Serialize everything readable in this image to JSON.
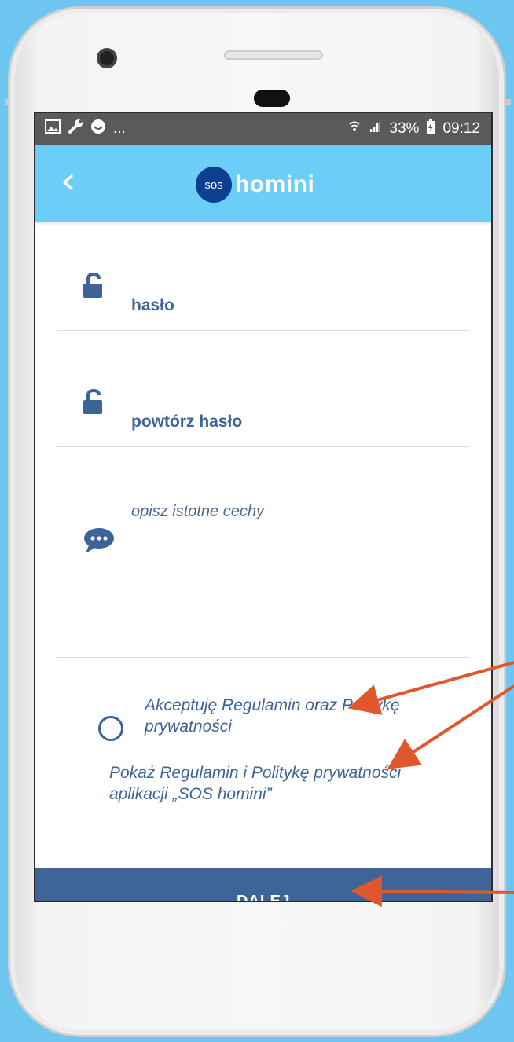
{
  "status_bar": {
    "left_icons": [
      "image-icon",
      "wrench-icon",
      "smiley-icon"
    ],
    "left_more": "...",
    "right_icons": [
      "wifi-icon",
      "signal-icon"
    ],
    "battery_percent": "33%",
    "time": "09:12"
  },
  "app_bar": {
    "back_icon": "chevron-left-icon",
    "logo_badge": "sos",
    "logo_text": "homini"
  },
  "form": {
    "password_label": "hasło",
    "repeat_password_label": "powtórz hasło",
    "description_placeholder": "opisz istotne cechy"
  },
  "terms": {
    "accept_label": "Akceptuję Regulamin oraz Politykę prywatności",
    "show_link": "Pokaż Regulamin i Politykę prywatności aplikacji „SOS homini”"
  },
  "next_button": "DALEJ",
  "colors": {
    "background": "#6cc6ef",
    "app_bar": "#6dcdf9",
    "primary": "#3f6497",
    "logo_badge": "#0c3f8d",
    "annotation_arrow": "#e2562b"
  }
}
